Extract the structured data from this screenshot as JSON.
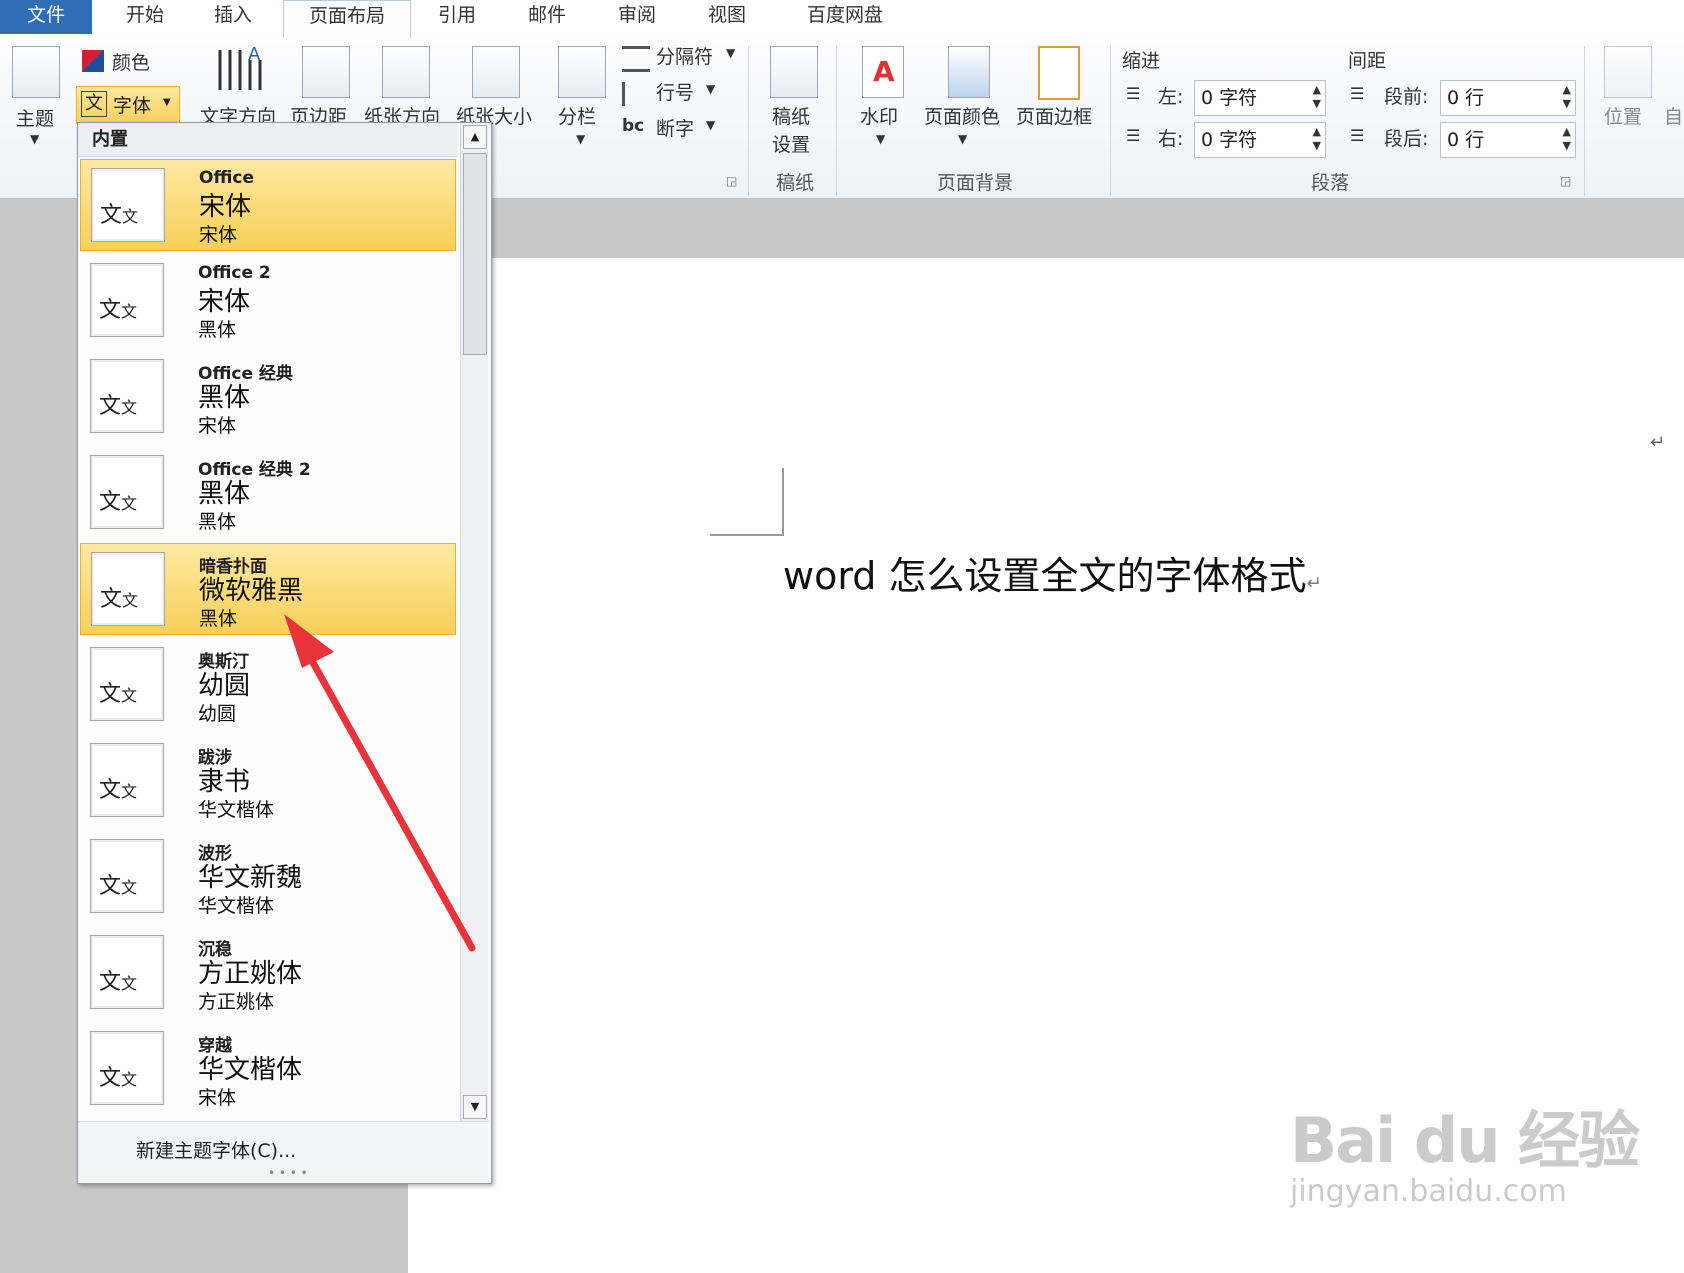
{
  "tabs": [
    {
      "label": "文件",
      "x": 0
    },
    {
      "label": "开始"
    },
    {
      "label": "插入"
    },
    {
      "label": "页面布局",
      "active": true
    },
    {
      "label": "引用"
    },
    {
      "label": "邮件"
    },
    {
      "label": "审阅"
    },
    {
      "label": "视图"
    },
    {
      "label": "百度网盘"
    }
  ],
  "ribbon": {
    "theme_group": {
      "theme_label": "主题",
      "colors_label": "颜色",
      "fonts_label": "字体",
      "fonts_icon_char": "文"
    },
    "page_setup": {
      "text_direction": "文字方向",
      "margins": "页边距",
      "orientation": "纸张方向",
      "size": "纸张大小",
      "columns": "分栏",
      "breaks": "分隔符",
      "line_numbers": "行号",
      "hyphenation": "断字",
      "hyphenation_prefix": "bc"
    },
    "manuscript": {
      "label_line1": "稿纸",
      "label_line2": "设置",
      "group": "稿纸"
    },
    "page_background": {
      "watermark": "水印",
      "page_color": "页面颜色",
      "page_borders": "页面边框",
      "group": "页面背景"
    },
    "paragraph": {
      "indent_title": "缩进",
      "spacing_title": "间距",
      "left_label": "左:",
      "left_value": "0 字符",
      "right_label": "右:",
      "right_value": "0 字符",
      "before_label": "段前:",
      "before_value": "0 行",
      "after_label": "段后:",
      "after_value": "0 行",
      "group": "段落"
    },
    "arrange": {
      "position": "位置",
      "partial": "自"
    }
  },
  "dropdown": {
    "header": "内置",
    "items": [
      {
        "name": "Office",
        "heading_font": "宋体",
        "body_font": "宋体",
        "selected": true
      },
      {
        "name": "Office 2",
        "heading_font": "宋体",
        "body_font": "黑体"
      },
      {
        "name": "Office 经典",
        "heading_font": "黑体",
        "body_font": "宋体"
      },
      {
        "name": "Office 经典 2",
        "heading_font": "黑体",
        "body_font": "黑体"
      },
      {
        "name": "暗香扑面",
        "heading_font": "微软雅黑",
        "body_font": "黑体",
        "selected": true
      },
      {
        "name": "奥斯汀",
        "heading_font": "幼圆",
        "body_font": "幼圆"
      },
      {
        "name": "跋涉",
        "heading_font": "隶书",
        "body_font": "华文楷体"
      },
      {
        "name": "波形",
        "heading_font": "华文新魏",
        "body_font": "华文楷体"
      },
      {
        "name": "沉稳",
        "heading_font": "方正姚体",
        "body_font": "方正姚体"
      },
      {
        "name": "穿越",
        "heading_font": "华文楷体",
        "body_font": "宋体"
      }
    ],
    "thumb_text": "文",
    "thumb_text_small": "文",
    "footer_action": "新建主题字体(C)..."
  },
  "document": {
    "title": "word 怎么设置全文的字体格式",
    "paragraph_mark": "↵"
  },
  "watermark": {
    "main": "Bai du 经验",
    "sub": "jingyan.baidu.com"
  },
  "colors": {
    "file_tab": "#2f6db7",
    "selection": "#f8cf58",
    "arrow": "#e8333a"
  }
}
